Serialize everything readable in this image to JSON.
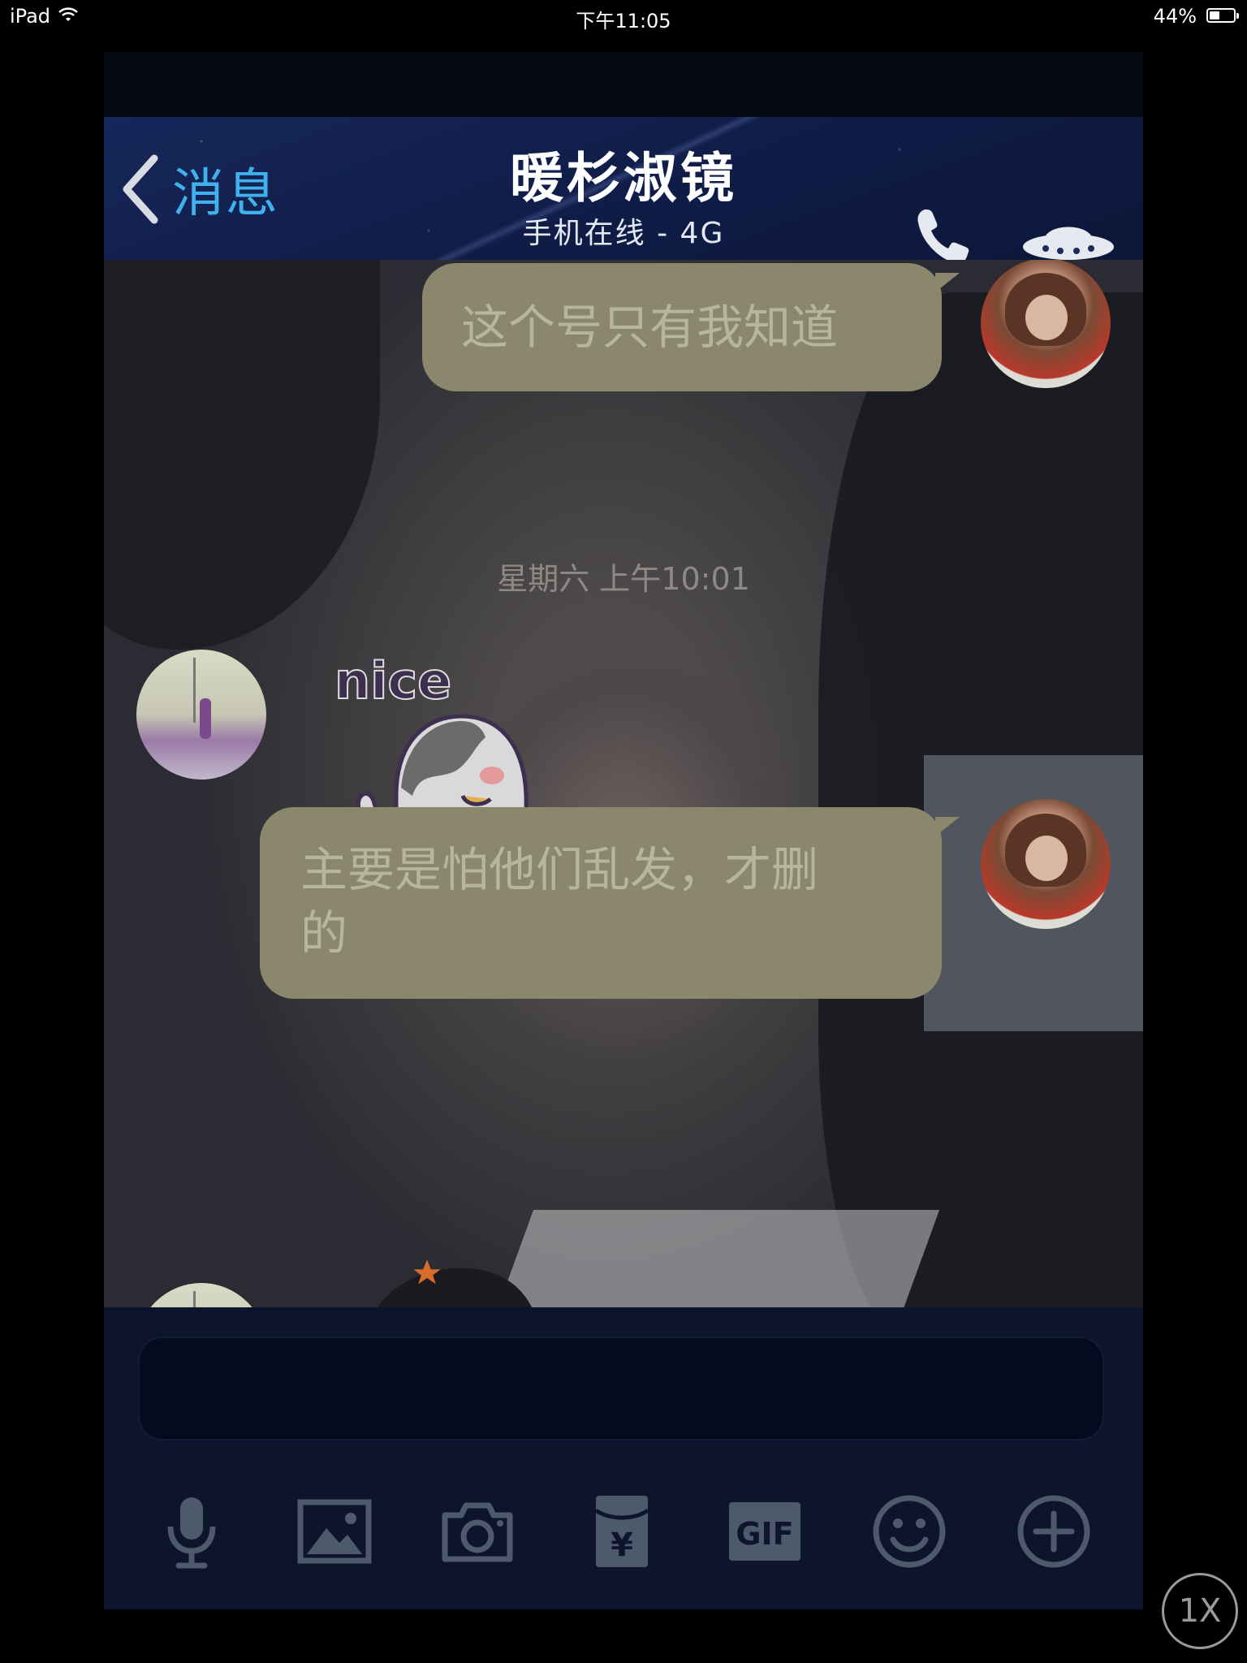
{
  "status_bar": {
    "device": "iPad",
    "time": "下午11:05",
    "battery_percent": "44%",
    "battery_level": 0.44
  },
  "header": {
    "back_label": "消息",
    "title": "暖杉淑镜",
    "subtitle": "手机在线 - 4G",
    "icons": [
      "phone-icon",
      "ufo-icon"
    ]
  },
  "messages": [
    {
      "side": "right",
      "type": "text",
      "text": "这个号只有我知道"
    },
    {
      "type": "timestamp",
      "text": "星期六 上午10:01"
    },
    {
      "side": "left",
      "type": "sticker",
      "text": "nice"
    },
    {
      "side": "right",
      "type": "text",
      "lines": [
        "主要是怕他们乱发，才删",
        "的"
      ]
    },
    {
      "side": "left",
      "type": "sticker"
    }
  ],
  "toolbar": {
    "icons": [
      "microphone-icon",
      "image-icon",
      "camera-icon",
      "red-packet-icon",
      "gif-icon",
      "emoji-icon",
      "plus-icon"
    ],
    "gif_label": "GIF",
    "yen_symbol": "¥"
  },
  "zoom_button": "1X",
  "colors": {
    "nav_background": "#132453",
    "back_label": "#3fb1ec",
    "bubble": "#8b876c",
    "bubble_text": "#b7b49f",
    "toolbar_icon": "#4e596c"
  }
}
